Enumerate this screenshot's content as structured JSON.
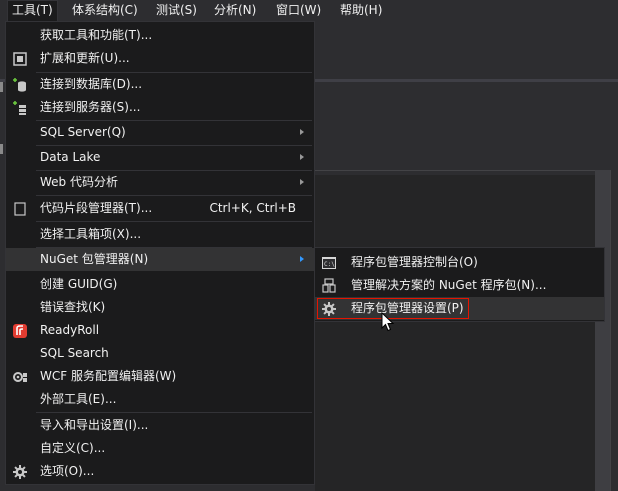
{
  "menubar": {
    "items": [
      {
        "label": "工具(T)",
        "open": true
      },
      {
        "label": "体系结构(C)"
      },
      {
        "label": "测试(S)"
      },
      {
        "label": "分析(N)"
      },
      {
        "label": "窗口(W)"
      },
      {
        "label": "帮助(H)"
      }
    ]
  },
  "tools_menu": {
    "items": [
      {
        "label": "获取工具和功能(T)...",
        "icon": "none"
      },
      {
        "label": "扩展和更新(U)...",
        "icon": "extensions-icon"
      },
      {
        "label": "连接到数据库(D)...",
        "icon": "database-connect-icon"
      },
      {
        "label": "连接到服务器(S)...",
        "icon": "server-connect-icon"
      },
      {
        "label": "SQL Server(Q)",
        "icon": "none",
        "submenu": true
      },
      {
        "label": "Data Lake",
        "icon": "none",
        "submenu": true
      },
      {
        "label": "Web 代码分析",
        "icon": "none",
        "submenu": true
      },
      {
        "label": "代码片段管理器(T)...",
        "shortcut": "Ctrl+K, Ctrl+B",
        "icon": "snippet-icon"
      },
      {
        "label": "选择工具箱项(X)...",
        "icon": "none"
      },
      {
        "label": "NuGet 包管理器(N)",
        "icon": "none",
        "submenu": true,
        "highlighted": true
      },
      {
        "label": "创建 GUID(G)",
        "icon": "none"
      },
      {
        "label": "错误查找(K)",
        "icon": "none"
      },
      {
        "label": "ReadyRoll",
        "icon": "readyroll-icon"
      },
      {
        "label": "SQL Search",
        "icon": "none"
      },
      {
        "label": "WCF 服务配置编辑器(W)",
        "icon": "wcf-config-icon"
      },
      {
        "label": "外部工具(E)...",
        "icon": "none"
      },
      {
        "label": "导入和导出设置(I)...",
        "icon": "none"
      },
      {
        "label": "自定义(C)...",
        "icon": "none"
      },
      {
        "label": "选项(O)...",
        "icon": "gear-icon"
      }
    ]
  },
  "nuget_submenu": {
    "items": [
      {
        "label": "程序包管理器控制台(O)",
        "icon": "console-icon"
      },
      {
        "label": "管理解决方案的 NuGet 程序包(N)...",
        "icon": "package-icon"
      },
      {
        "label": "程序包管理器设置(P)",
        "icon": "gear-icon",
        "highlighted": true
      }
    ]
  },
  "colors": {
    "menu_bg": "#1b1b1c",
    "highlight": "#333334",
    "focus_border": "#e51400",
    "text": "#f1f1f1"
  }
}
